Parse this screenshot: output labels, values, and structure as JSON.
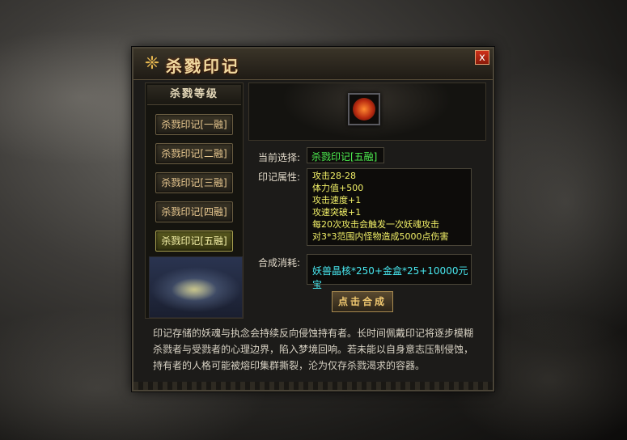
{
  "window": {
    "title": "杀戮印记",
    "close_label": "x"
  },
  "left": {
    "header": "杀戮等级",
    "levels": [
      "杀戮印记[一融]",
      "杀戮印记[二融]",
      "杀戮印记[三融]",
      "杀戮印记[四融]",
      "杀戮印记[五融]"
    ],
    "active_index": 4
  },
  "detail": {
    "current_label": "当前选择:",
    "current_value": "杀戮印记[五融]",
    "attr_label": "印记属性:",
    "attributes": [
      "攻击28-28",
      "体力值+500",
      "攻击速度+1",
      "攻速突破+1",
      "每20次攻击会触发一次妖魂攻击",
      "对3*3范围内怪物造成5000点伤害"
    ],
    "cost_label": "合成消耗:",
    "cost_value": "妖兽晶核*250+金盒*25+10000元宝",
    "synth_button": "点击合成"
  },
  "description": "印记存储的妖魂与执念会持续反向侵蚀持有者。长时间佩戴印记将逐步模糊杀戮者与受戮者的心理边界，陷入梦境回响。若未能以自身意志压制侵蚀，持有者的人格可能被熔印集群撕裂，沦为仅存杀戮渴求的容器。",
  "colors": {
    "attribute_text": "#f2f068",
    "selected_text": "#4ef050",
    "cost_text": "#48e8f0"
  }
}
